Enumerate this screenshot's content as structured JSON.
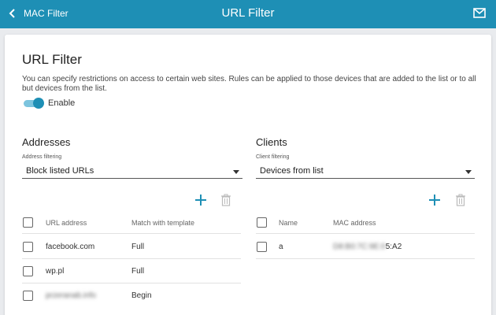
{
  "header": {
    "back_label": "MAC Filter",
    "title": "URL Filter",
    "mail_icon": "mail-icon"
  },
  "page": {
    "title": "URL Filter",
    "description": "You can specify restrictions on access to certain web sites. Rules can be applied to those devices that are added to the list or to all but devices from the list.",
    "toggle_label": "Enable",
    "toggle_on": true,
    "accent_color": "#1e8fb5"
  },
  "addresses": {
    "heading": "Addresses",
    "filter_label": "Address filtering",
    "filter_value": "Block listed URLs",
    "columns": [
      "URL address",
      "Match with template"
    ],
    "rows": [
      {
        "url": "facebook.com",
        "match": "Full"
      },
      {
        "url": "wp.pl",
        "match": "Full"
      },
      {
        "url": "przeranab.info",
        "match": "Begin"
      }
    ]
  },
  "clients": {
    "heading": "Clients",
    "filter_label": "Client filtering",
    "filter_value": "Devices from list",
    "columns": [
      "Name",
      "MAC address"
    ],
    "rows": [
      {
        "name": "a",
        "mac_hidden": "D8:B0:7C:9E:0",
        "mac_visible": "5:A2"
      }
    ]
  }
}
